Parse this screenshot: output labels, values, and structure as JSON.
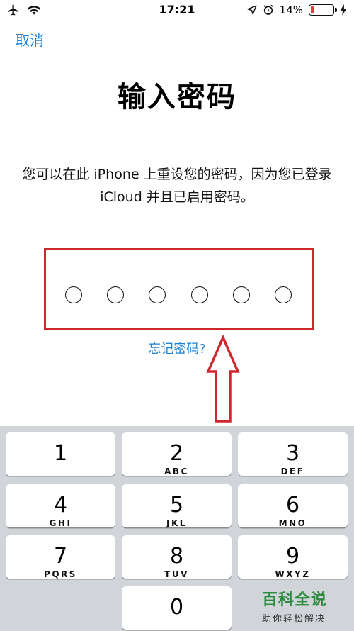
{
  "status_bar": {
    "time": "17:21",
    "battery_percent": "14%",
    "battery_level": 0.14
  },
  "header": {
    "cancel_label": "取消",
    "title": "输入密码"
  },
  "description": "您可以在此 iPhone 上重设您的密码，因为您已登录 iCloud 并且已启用密码。",
  "passcode": {
    "length": 6,
    "entered": 0
  },
  "forgot_label": "忘记密码?",
  "keypad": {
    "keys": [
      {
        "digit": "1",
        "letters": ""
      },
      {
        "digit": "2",
        "letters": "ABC"
      },
      {
        "digit": "3",
        "letters": "DEF"
      },
      {
        "digit": "4",
        "letters": "GHI"
      },
      {
        "digit": "5",
        "letters": "JKL"
      },
      {
        "digit": "6",
        "letters": "MNO"
      },
      {
        "digit": "7",
        "letters": "PQRS"
      },
      {
        "digit": "8",
        "letters": "TUV"
      },
      {
        "digit": "9",
        "letters": "WXYZ"
      },
      {
        "digit": "0",
        "letters": ""
      }
    ]
  },
  "watermark": {
    "title": "百科全说",
    "subtitle": "助你轻松解决"
  },
  "colors": {
    "accent": "#1e82d3",
    "annotation": "#d0262d",
    "watermark": "#2a8a3e"
  }
}
